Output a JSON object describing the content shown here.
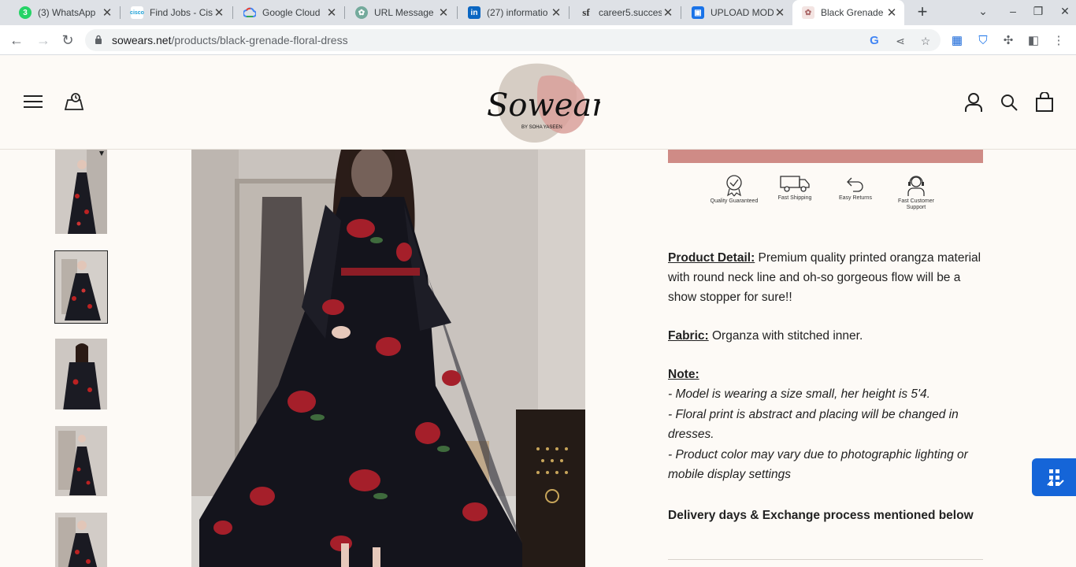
{
  "browser": {
    "tabs": [
      {
        "title": "(3) WhatsApp",
        "favicon": "whatsapp-icon",
        "color": "#25d366"
      },
      {
        "title": "Find Jobs - Cis",
        "favicon": "cisco-icon",
        "color": "#1ba0d7"
      },
      {
        "title": "Google Cloud",
        "favicon": "google-cloud-icon",
        "color": "#4285f4"
      },
      {
        "title": "URL Message",
        "favicon": "chatgpt-icon",
        "color": "#74aa9c"
      },
      {
        "title": "(27) informatio",
        "favicon": "linkedin-icon",
        "color": "#0a66c2"
      },
      {
        "title": "career5.succes",
        "favicon": "successfactors-icon",
        "color": "#333333"
      },
      {
        "title": "UPLOAD MODI",
        "favicon": "contact-card-icon",
        "color": "#1a73e8"
      },
      {
        "title": "Black Grenade",
        "favicon": "sowears-icon",
        "color": "#c88",
        "active": true
      }
    ],
    "url_domain": "sowears.net",
    "url_path": "/products/black-grenade-floral-dress"
  },
  "site": {
    "brand": "Sowears",
    "brand_sub": "BY SOHA YASEEN",
    "accent": "#cf8b86"
  },
  "badges": [
    {
      "label": "Quality Guaranteed",
      "icon": "quality-icon"
    },
    {
      "label": "Fast Shipping",
      "icon": "truck-icon"
    },
    {
      "label": "Easy Returns",
      "icon": "return-icon"
    },
    {
      "label": "Fast Customer Support",
      "icon": "support-icon"
    }
  ],
  "product": {
    "detail_label": "Product Detail:",
    "detail_text": " Premium quality printed orangza material with round neck line and oh-so gorgeous flow will be a show stopper for sure!!",
    "fabric_label": "Fabric:",
    "fabric_text": " Organza with stitched inner.",
    "note_label": "Note:",
    "notes": [
      "- Model is wearing a size small, her height is 5'4.",
      "- Floral print is abstract and placing will be changed in dresses.",
      "- Product color may vary due to photographic lighting or mobile display settings"
    ],
    "delivery": "Delivery days & Exchange process mentioned below"
  }
}
